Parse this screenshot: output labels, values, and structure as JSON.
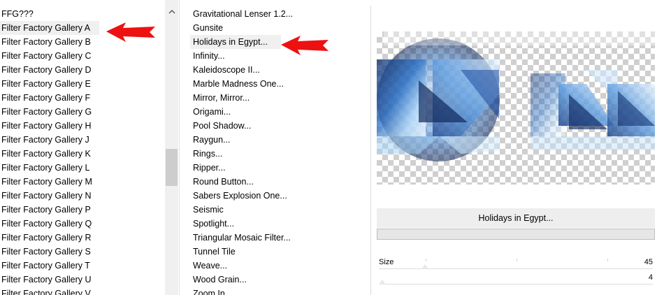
{
  "categories": {
    "items": [
      "FFG???",
      "Filter Factory Gallery A",
      "Filter Factory Gallery B",
      "Filter Factory Gallery C",
      "Filter Factory Gallery D",
      "Filter Factory Gallery E",
      "Filter Factory Gallery F",
      "Filter Factory Gallery G",
      "Filter Factory Gallery H",
      "Filter Factory Gallery J",
      "Filter Factory Gallery K",
      "Filter Factory Gallery L",
      "Filter Factory Gallery M",
      "Filter Factory Gallery N",
      "Filter Factory Gallery P",
      "Filter Factory Gallery Q",
      "Filter Factory Gallery R",
      "Filter Factory Gallery S",
      "Filter Factory Gallery T",
      "Filter Factory Gallery U",
      "Filter Factory Gallery V"
    ],
    "selected_index": 1
  },
  "filters": {
    "items": [
      "Gravitational Lenser 1.2...",
      "Gunsite",
      "Holidays in Egypt...",
      "Infinity...",
      "Kaleidoscope II...",
      "Marble Madness One...",
      "Mirror, Mirror...",
      "Origami...",
      "Pool Shadow...",
      "Raygun...",
      "Rings...",
      "Ripper...",
      "Round Button...",
      "Sabers Explosion One...",
      "Seismic",
      "Spotlight...",
      "Triangular Mosaic Filter...",
      "Tunnel Tile",
      "Weave...",
      "Wood Grain...",
      "Zoom In..."
    ],
    "selected_index": 2
  },
  "preview": {
    "filter_name": "Holidays in Egypt...",
    "progress": 0
  },
  "params": [
    {
      "label": "Size",
      "value": "45"
    },
    {
      "label": "",
      "value": "4"
    }
  ],
  "colors": {
    "arrow": "#ee1111",
    "selection": "#f0f0f0",
    "scrollbar": "#f0f0f0",
    "preview_blue": "#2a6fc4"
  },
  "icons": {
    "scroll_up": "chevron-up-icon",
    "annotation": "red-arrow-icon"
  }
}
